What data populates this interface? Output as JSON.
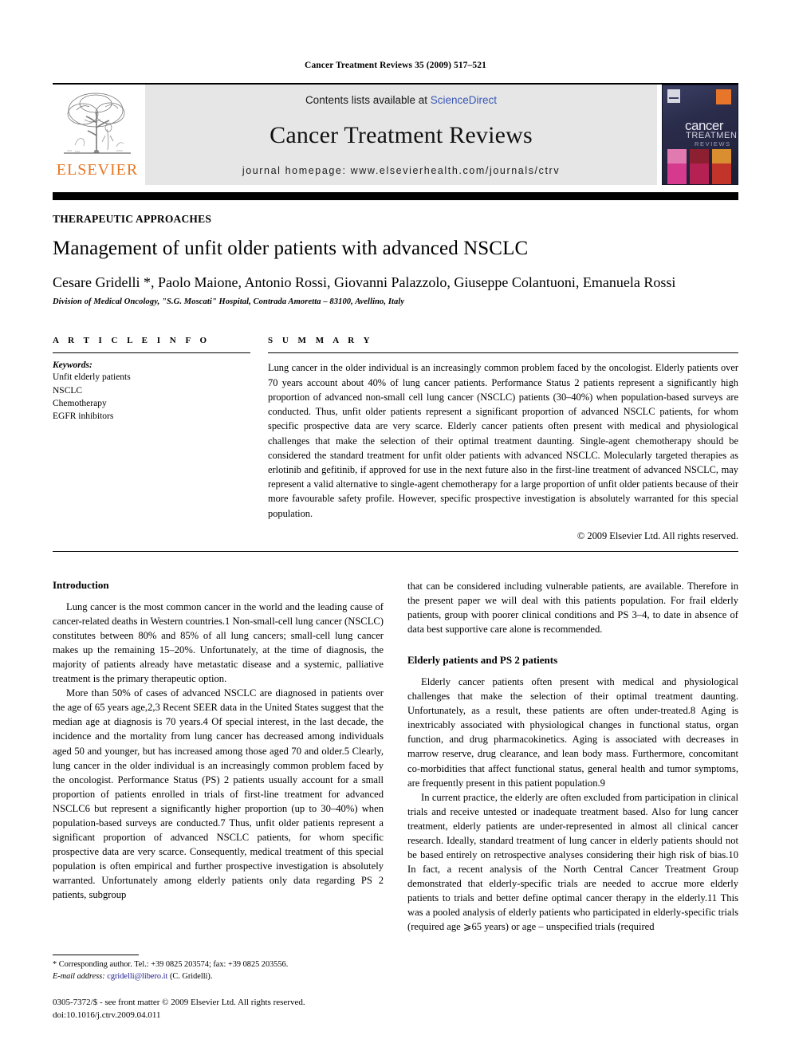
{
  "running_head": "Cancer Treatment Reviews 35 (2009) 517–521",
  "masthead": {
    "elsevier_wordmark": "ELSEVIER",
    "contents_prefix": "Contents lists available at ",
    "contents_link": "ScienceDirect",
    "journal_title": "Cancer Treatment Reviews",
    "homepage_line": "journal homepage: www.elsevierhealth.com/journals/ctrv",
    "cover": {
      "line1": "cancer",
      "line2": "TREATMENT",
      "line3": "REVIEWS"
    }
  },
  "article": {
    "kicker": "THERAPEUTIC APPROACHES",
    "title": "Management of unfit older patients with advanced NSCLC",
    "authors": "Cesare Gridelli *, Paolo Maione, Antonio Rossi, Giovanni Palazzolo, Giuseppe Colantuoni, Emanuela Rossi",
    "affiliation": "Division of Medical Oncology, \"S.G. Moscati\" Hospital, Contrada Amoretta – 83100, Avellino, Italy"
  },
  "article_info": {
    "heading": "A R T I C L E   I N F O",
    "keywords_label": "Keywords:",
    "keywords": [
      "Unfit elderly patients",
      "NSCLC",
      "Chemotherapy",
      "EGFR inhibitors"
    ]
  },
  "summary": {
    "heading": "S U M M A R Y",
    "text": "Lung cancer in the older individual is an increasingly common problem faced by the oncologist. Elderly patients over 70 years account about 40% of lung cancer patients. Performance Status 2 patients represent a significantly high proportion of advanced non-small cell lung cancer (NSCLC) patients (30–40%) when population-based surveys are conducted. Thus, unfit older patients represent a significant proportion of advanced NSCLC patients, for whom specific prospective data are very scarce. Elderly cancer patients often present with medical and physiological challenges that make the selection of their optimal treatment daunting. Single-agent chemotherapy should be considered the standard treatment for unfit older patients with advanced NSCLC. Molecularly targeted therapies as erlotinib and gefitinib, if approved for use in the next future also in the first-line treatment of advanced NSCLC, may represent a valid alternative to single-agent chemotherapy for a large proportion of unfit older patients because of their more favourable safety profile. However, specific prospective investigation is absolutely warranted for this special population.",
    "copyright": "© 2009 Elsevier Ltd. All rights reserved."
  },
  "body": {
    "left": {
      "heading": "Introduction",
      "paragraph1": "Lung cancer is the most common cancer in the world and the leading cause of cancer-related deaths in Western countries.1 Non-small-cell lung cancer (NSCLC) constitutes between 80% and 85% of all lung cancers; small-cell lung cancer makes up the remaining 15–20%. Unfortunately, at the time of diagnosis, the majority of patients already have metastatic disease and a systemic, palliative treatment is the primary therapeutic option.",
      "paragraph2": "More than 50% of cases of advanced NSCLC are diagnosed in patients over the age of 65 years age,2,3 Recent SEER data in the United States suggest that the median age at diagnosis is 70 years.4 Of special interest, in the last decade, the incidence and the mortality from lung cancer has decreased among individuals aged 50 and younger, but has increased among those aged 70 and older.5 Clearly, lung cancer in the older individual is an increasingly common problem faced by the oncologist. Performance Status (PS) 2 patients usually account for a small proportion of patients enrolled in trials of first-line treatment for advanced NSCLC6 but represent a significantly higher proportion (up to 30–40%) when population-based surveys are conducted.7 Thus, unfit older patients represent a significant proportion of advanced NSCLC patients, for whom specific prospective data are very scarce. Consequently, medical treatment of this special population is often empirical and further prospective investigation is absolutely warranted. Unfortunately among elderly patients only data regarding PS 2 patients, subgroup"
    },
    "right": {
      "paragraph1": "that can be considered including vulnerable patients, are available. Therefore in the present paper we will deal with this patients population. For frail elderly patients, group with poorer clinical conditions and PS 3–4, to date in absence of data best supportive care alone is recommended.",
      "heading": "Elderly patients and PS 2 patients",
      "paragraph2": "Elderly cancer patients often present with medical and physiological challenges that make the selection of their optimal treatment daunting. Unfortunately, as a result, these patients are often under-treated.8 Aging is inextricably associated with physiological changes in functional status, organ function, and drug pharmacokinetics. Aging is associated with decreases in marrow reserve, drug clearance, and lean body mass. Furthermore, concomitant co-morbidities that affect functional status, general health and tumor symptoms, are frequently present in this patient population.9",
      "paragraph3": "In current practice, the elderly are often excluded from participation in clinical trials and receive untested or inadequate treatment based. Also for lung cancer treatment, elderly patients are under-represented in almost all clinical cancer research. Ideally, standard treatment of lung cancer in elderly patients should not be based entirely on retrospective analyses considering their high risk of bias.10 In fact, a recent analysis of the North Central Cancer Treatment Group demonstrated that elderly-specific trials are needed to accrue more elderly patients to trials and better define optimal cancer therapy in the elderly.11 This was a pooled analysis of elderly patients who participated in elderly-specific trials (required age ⩾65 years) or age – unspecified trials (required"
    }
  },
  "footnotes": {
    "corresponding": "* Corresponding author. Tel.: +39 0825 203574; fax: +39 0825 203556.",
    "email_label": "E-mail address:",
    "email": "cgridelli@libero.it",
    "email_suffix": " (C. Gridelli).",
    "issn_line": "0305-7372/$ - see front matter © 2009 Elsevier Ltd. All rights reserved.",
    "doi_line": "doi:10.1016/j.ctrv.2009.04.011"
  },
  "colors": {
    "elsevier_orange": "#E87722",
    "link_blue": "#3a57b5",
    "mail_blue": "#1a1a8c",
    "band_gray": "#e6e6e6"
  }
}
